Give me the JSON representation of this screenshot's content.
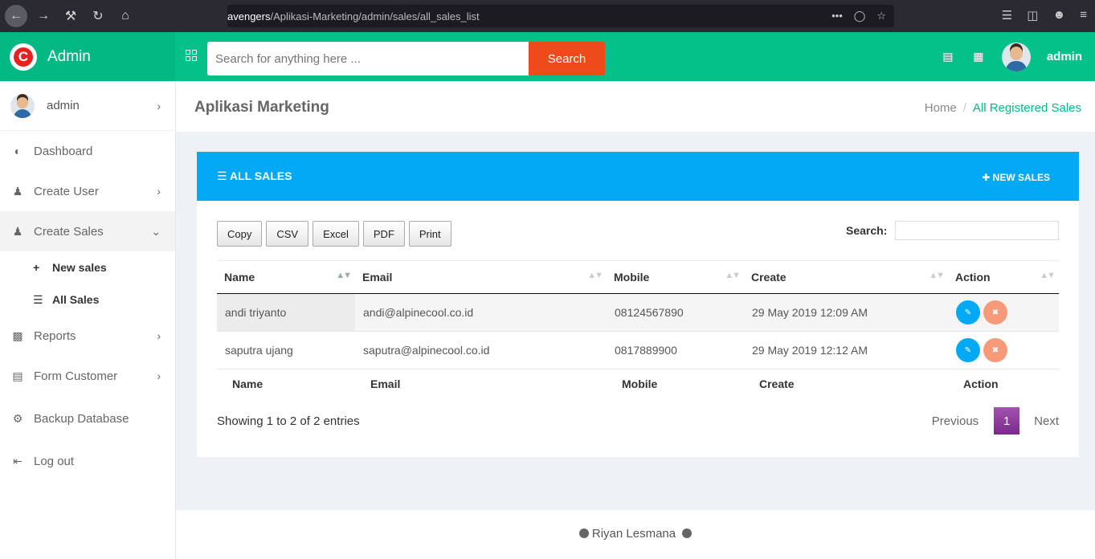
{
  "browser": {
    "url_host": "avengers",
    "url_path": "/Aplikasi-Marketing/admin/sales/all_sales_list"
  },
  "header": {
    "brand_letter": "C",
    "brand_name": "Admin",
    "search_placeholder": "Search for anything here ...",
    "search_button": "Search",
    "user_name": "admin"
  },
  "sidebar": {
    "user_name": "admin",
    "items": [
      {
        "label": "Dashboard",
        "icon": "dashboard-icon"
      },
      {
        "label": "Create User",
        "icon": "user-icon"
      },
      {
        "label": "Create Sales",
        "icon": "user-icon"
      },
      {
        "label": "Reports",
        "icon": "bar-chart-icon"
      },
      {
        "label": "Form Customer",
        "icon": "document-icon"
      },
      {
        "label": "Backup Database",
        "icon": "gear-icon"
      },
      {
        "label": "Log out",
        "icon": "logout-icon"
      }
    ],
    "sub_items": [
      {
        "label": "New sales",
        "icon": "plus-icon"
      },
      {
        "label": "All Sales",
        "icon": "list-icon"
      }
    ]
  },
  "page": {
    "title": "Aplikasi Marketing",
    "breadcrumb_home": "Home",
    "breadcrumb_current": "All Registered Sales"
  },
  "card": {
    "title": "ALL SALES",
    "new_button": "NEW SALES",
    "export_buttons": [
      "Copy",
      "CSV",
      "Excel",
      "PDF",
      "Print"
    ],
    "search_label": "Search:",
    "columns": [
      "Name",
      "Email",
      "Mobile",
      "Create",
      "Action"
    ],
    "rows": [
      {
        "name": "andi triyanto",
        "email": "andi@alpinecool.co.id",
        "mobile": "08124567890",
        "create": "29 May 2019 12:09 AM"
      },
      {
        "name": "saputra ujang",
        "email": "saputra@alpinecool.co.id",
        "mobile": "0817889900",
        "create": "29 May 2019 12:12 AM"
      }
    ],
    "info": "Showing 1 to 2 of 2 entries",
    "pager": {
      "previous": "Previous",
      "current": "1",
      "next": "Next"
    }
  },
  "footer": {
    "text": "Riyan Lesmana"
  }
}
